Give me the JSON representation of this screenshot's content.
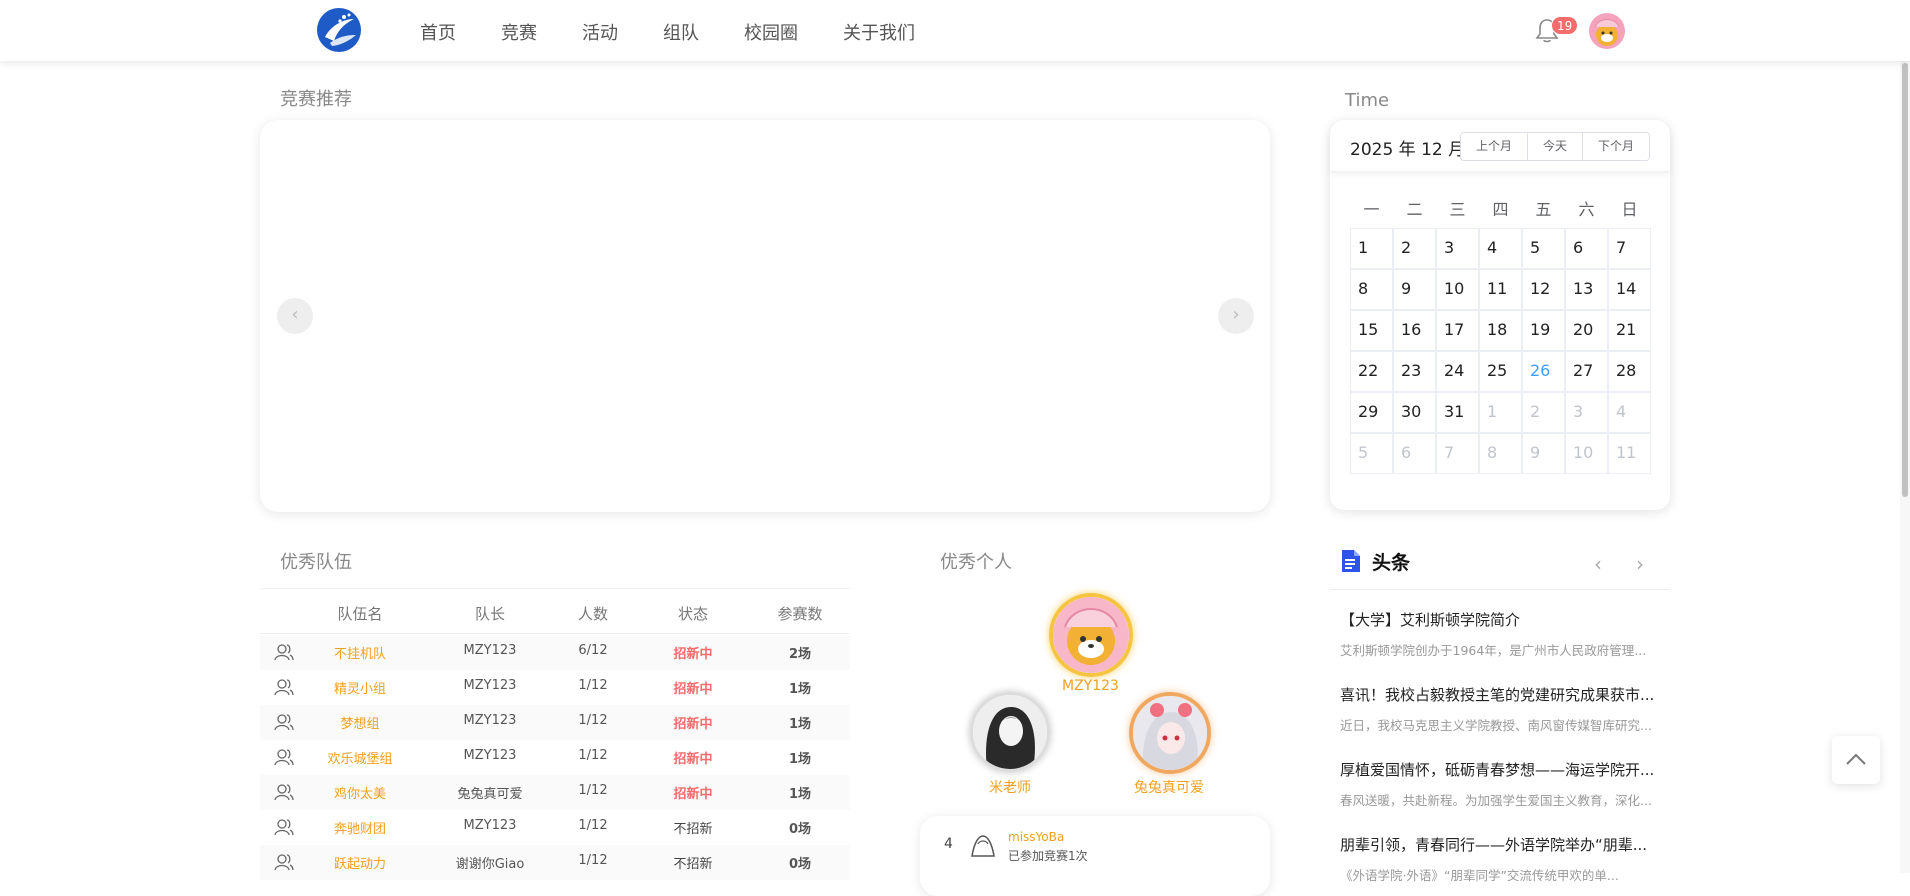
{
  "nav": {
    "items": [
      "首页",
      "竞赛",
      "活动",
      "组队",
      "校园圈",
      "关于我们"
    ],
    "notification_count": "19"
  },
  "sections": {
    "recommend": "竞赛推荐",
    "time": "Time",
    "teams": "优秀队伍",
    "persons": "优秀个人",
    "headlines": "头条"
  },
  "calendar": {
    "title": "2025 年 12 月",
    "buttons": [
      "上个月",
      "今天",
      "下个月"
    ],
    "weekdays": [
      "一",
      "二",
      "三",
      "四",
      "五",
      "六",
      "日"
    ],
    "days": [
      [
        "1",
        "2",
        "3",
        "4",
        "5",
        "6",
        "7"
      ],
      [
        "8",
        "9",
        "10",
        "11",
        "12",
        "13",
        "14"
      ],
      [
        "15",
        "16",
        "17",
        "18",
        "19",
        "20",
        "21"
      ],
      [
        "22",
        "23",
        "24",
        "25",
        "26",
        "27",
        "28"
      ],
      [
        "29",
        "30",
        "31",
        "1",
        "2",
        "3",
        "4"
      ],
      [
        "5",
        "6",
        "7",
        "8",
        "9",
        "10",
        "11"
      ]
    ],
    "today": "26"
  },
  "teams": {
    "headers": [
      "队伍名",
      "队长",
      "人数",
      "状态",
      "参赛数"
    ],
    "rows": [
      {
        "name": "不挂机队",
        "leader": "MZY123",
        "count": "6/12",
        "status": "招新中",
        "games": "2场"
      },
      {
        "name": "精灵小组",
        "leader": "MZY123",
        "count": "1/12",
        "status": "招新中",
        "games": "1场"
      },
      {
        "name": "梦想组",
        "leader": "MZY123",
        "count": "1/12",
        "status": "招新中",
        "games": "1场"
      },
      {
        "name": "欢乐城堡组",
        "leader": "MZY123",
        "count": "1/12",
        "status": "招新中",
        "games": "1场"
      },
      {
        "name": "鸡你太美",
        "leader": "兔兔真可爱",
        "count": "1/12",
        "status": "招新中",
        "games": "1场"
      },
      {
        "name": "奔驰财团",
        "leader": "MZY123",
        "count": "1/12",
        "status": "不招新",
        "games": "0场"
      },
      {
        "name": "跃起动力",
        "leader": "谢谢你Giao",
        "count": "1/12",
        "status": "不招新",
        "games": "0场"
      }
    ]
  },
  "persons": {
    "first": "MZY123",
    "second": "米老师",
    "third": "兔兔真可爱",
    "rank4": {
      "rank": "4",
      "name": "missYoBa",
      "desc": "已参加竞赛1次"
    }
  },
  "news": [
    {
      "title": "【大学】艾利斯顿学院简介",
      "desc": "艾利斯顿学院创办于1964年，是广州市人民政府管理..."
    },
    {
      "title": "喜讯！我校占毅教授主笔的党建研究成果获市...",
      "desc": "近日，我校马克思主义学院教授、南风窗传媒智库研究..."
    },
    {
      "title": "厚植爱国情怀，砥砺青春梦想——海运学院开...",
      "desc": "春风送暖，共赴新程。为加强学生爱国主义教育，深化..."
    },
    {
      "title": "朋辈引领，青春同行——外语学院举办“朋辈...",
      "desc": "《外语学院·外语》“朋辈同学”交流传统甲欢的单..."
    }
  ],
  "colors": {
    "accent": "#409eff",
    "team_name": "#f0a020",
    "recruiting": "#f56c6c",
    "badge": "#f56c6c"
  }
}
